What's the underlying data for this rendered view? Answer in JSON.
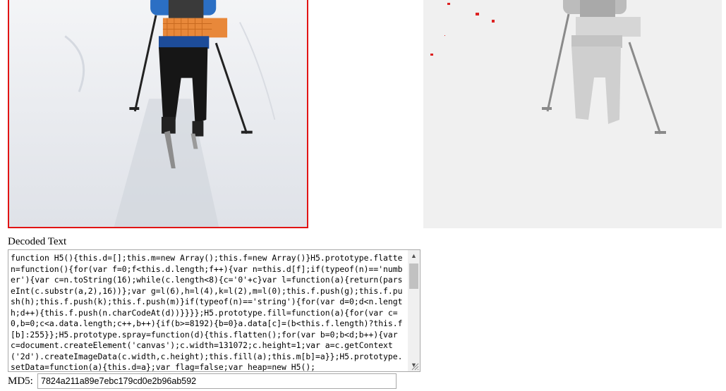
{
  "labels": {
    "decoded_text": "Decoded Text",
    "md5": "MD5:"
  },
  "decoded_text_value": "function H5(){this.d=[];this.m=new Array();this.f=new Array()}H5.prototype.flatten=function(){for(var f=0;f<this.d.length;f++){var n=this.d[f];if(typeof(n)=='number'){var c=n.toString(16);while(c.length<8){c='0'+c}var l=function(a){return(parseInt(c.substr(a,2),16))};var g=l(6),h=l(4),k=l(2),m=l(0);this.f.push(g);this.f.push(h);this.f.push(k);this.f.push(m)}if(typeof(n)=='string'){for(var d=0;d<n.length;d++){this.f.push(n.charCodeAt(d))}}}};H5.prototype.fill=function(a){for(var c=0,b=0;c<a.data.length;c++,b++){if(b>=8192){b=0}a.data[c]=(b<this.f.length)?this.f[b]:255}};H5.prototype.spray=function(d){this.flatten();for(var b=0;b<d;b++){var c=document.createElement('canvas');c.width=131072;c.height=1;var a=c.getContext('2d').createImageData(c.width,c.height);this.fill(a);this.m[b]=a}};H5.prototype.setData=function(a){this.d=a};var flag=false;var heap=new H5();",
  "md5_value": "7824a211a89e7ebc179cd0e2b96ab592",
  "colors": {
    "selected_border": "#e11414"
  }
}
